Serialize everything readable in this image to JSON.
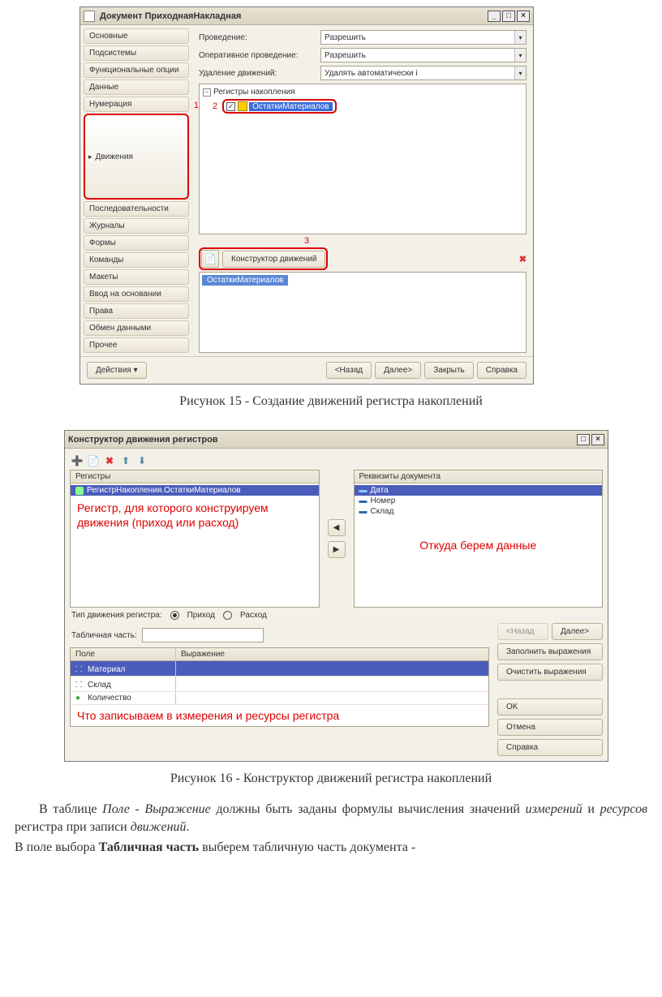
{
  "win1": {
    "title": "Документ ПриходнаяНакладная",
    "sidebar": [
      "Основные",
      "Подсистемы",
      "Функциональные опции",
      "Данные",
      "Нумерация",
      "Движения",
      "Последовательности",
      "Журналы",
      "Формы",
      "Команды",
      "Макеты",
      "Ввод на основании",
      "Права",
      "Обмен данными",
      "Прочее"
    ],
    "selected_index": 5,
    "fields": {
      "label_provedenie": "Проведение:",
      "val_provedenie": "Разрешить",
      "label_oper": "Оперативное проведение:",
      "val_oper": "Разрешить",
      "label_udal": "Удаление движений:",
      "val_udal": "Удалять автоматически і"
    },
    "tree": {
      "root": "Регистры накопления",
      "child": "ОстаткиМатериалов"
    },
    "btn_constructor": "Конструктор движений",
    "chip": "ОстаткиМатериалов",
    "buttons": {
      "actions": "Действия",
      "back": "<Назад",
      "next": "Далее>",
      "close": "Закрыть",
      "help": "Справка"
    },
    "markers": {
      "1": "1",
      "2": "2",
      "3": "3"
    }
  },
  "caption1": "Рисунок 15 - Создание движений регистра накоплений",
  "win2": {
    "title": "Конструктор движения регистров",
    "registers_header": "Регистры",
    "register_row": "РегистрНакопления.ОстаткиМатериалов",
    "annot_reg": "Регистр, для которого конструируем движения (приход или расход)",
    "attrs_header": "Реквизиты документа",
    "attrs": [
      "Дата",
      "Номер",
      "Склад"
    ],
    "annot_attrs": "Откуда берем данные",
    "type_label": "Тип движения регистра:",
    "type_in": "Приход",
    "type_out": "Расход",
    "tab_label": "Табличная часть:",
    "grid_h1": "Поле",
    "grid_h2": "Выражение",
    "grid_rows": [
      "Материал",
      "Склад",
      "Количество"
    ],
    "annot_grid": "Что записываем в измерения и ресурсы регистра",
    "buttons": {
      "back": "<Назад",
      "next": "Далее>",
      "fill": "Заполнить выражения",
      "clear": "Очистить выражения",
      "ok": "OK",
      "cancel": "Отмена",
      "help": "Справка"
    }
  },
  "caption2": "Рисунок 16 - Конструктор движений регистра накоплений",
  "text": {
    "p1a": "В таблице ",
    "p1b": "Поле",
    "p1c": " - ",
    "p1d": "Выражение",
    "p1e": " должны быть заданы формулы вычисления значений ",
    "p1f": "измерений",
    "p1g": " и ",
    "p1h": "ресурсов",
    "p1i": " регистра при записи ",
    "p1j": "движений",
    "p1k": ".",
    "p2a": "В поле выбора ",
    "p2b": "Табличная часть",
    "p2c": " выберем табличную часть документа -"
  }
}
